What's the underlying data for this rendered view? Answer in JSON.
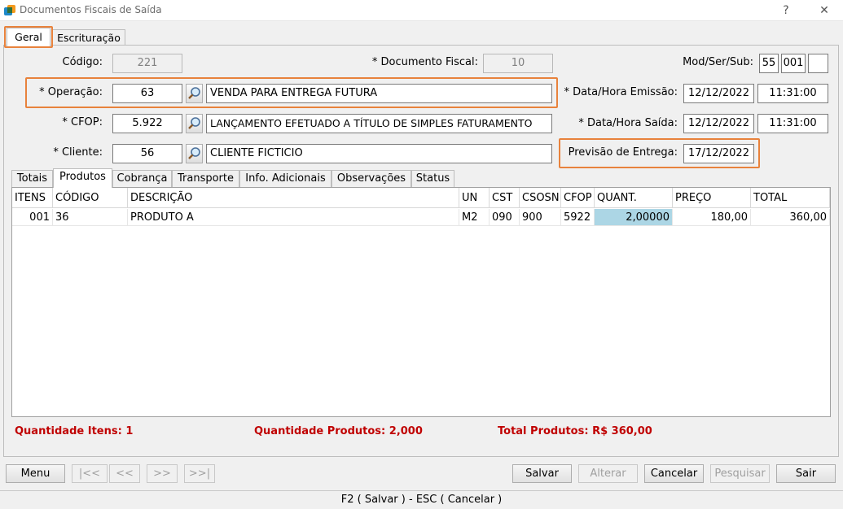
{
  "window": {
    "title": "Documentos Fiscais de Saída",
    "help": "?",
    "close": "✕"
  },
  "tabs": [
    "Geral",
    "Escrituração"
  ],
  "form": {
    "codigo": {
      "label": "Código:",
      "value": "221"
    },
    "documento_fiscal": {
      "label": "* Documento Fiscal:",
      "value": "10"
    },
    "mod_ser_sub": {
      "label": "Mod/Ser/Sub:",
      "mod": "55",
      "ser": "001",
      "sub": ""
    },
    "operacao": {
      "label": "* Operação:",
      "code": "63",
      "description": "VENDA PARA ENTREGA FUTURA"
    },
    "cfop": {
      "label": "* CFOP:",
      "code": "5.922",
      "description": "LANÇAMENTO EFETUADO A TÍTULO DE SIMPLES FATURAMENTO"
    },
    "cliente": {
      "label": "* Cliente:",
      "code": "56",
      "description": "CLIENTE FICTICIO"
    },
    "data_emissao": {
      "label": "* Data/Hora Emissão:",
      "date": "12/12/2022",
      "time": "11:31:00"
    },
    "data_saida": {
      "label": "* Data/Hora Saída:",
      "date": "12/12/2022",
      "time": "11:31:00"
    },
    "previsao": {
      "label": "Previsão de Entrega:",
      "date": "17/12/2022"
    }
  },
  "subtabs": [
    "Totais",
    "Produtos",
    "Cobrança",
    "Transporte",
    "Info. Adicionais",
    "Observações",
    "Status"
  ],
  "grid": {
    "columns": [
      "ITENS",
      "CÓDIGO",
      "DESCRIÇÃO",
      "UN",
      "CST",
      "CSOSN",
      "CFOP",
      "QUANT.",
      "PREÇO",
      "TOTAL"
    ],
    "rows": [
      [
        "001",
        "36",
        "PRODUTO A",
        "M2",
        "090",
        "900",
        "5922",
        "2,00000",
        "180,00",
        "360,00"
      ]
    ]
  },
  "summary": {
    "itens": "Quantidade Itens: 1",
    "produtos": "Quantidade Produtos: 2,000",
    "total": "Total Produtos: R$ 360,00"
  },
  "buttons": {
    "menu": "Menu",
    "first": "|<<",
    "prev": "<<",
    "next": ">>",
    "last": ">>|",
    "salvar": "Salvar",
    "alterar": "Alterar",
    "cancelar": "Cancelar",
    "pesquisar": "Pesquisar",
    "sair": "Sair"
  },
  "status_bar": "F2 ( Salvar )  -  ESC ( Cancelar )",
  "colors": {
    "highlight": "#e8823c",
    "summary_text": "#c00000",
    "selected_cell": "#acd6e5"
  }
}
